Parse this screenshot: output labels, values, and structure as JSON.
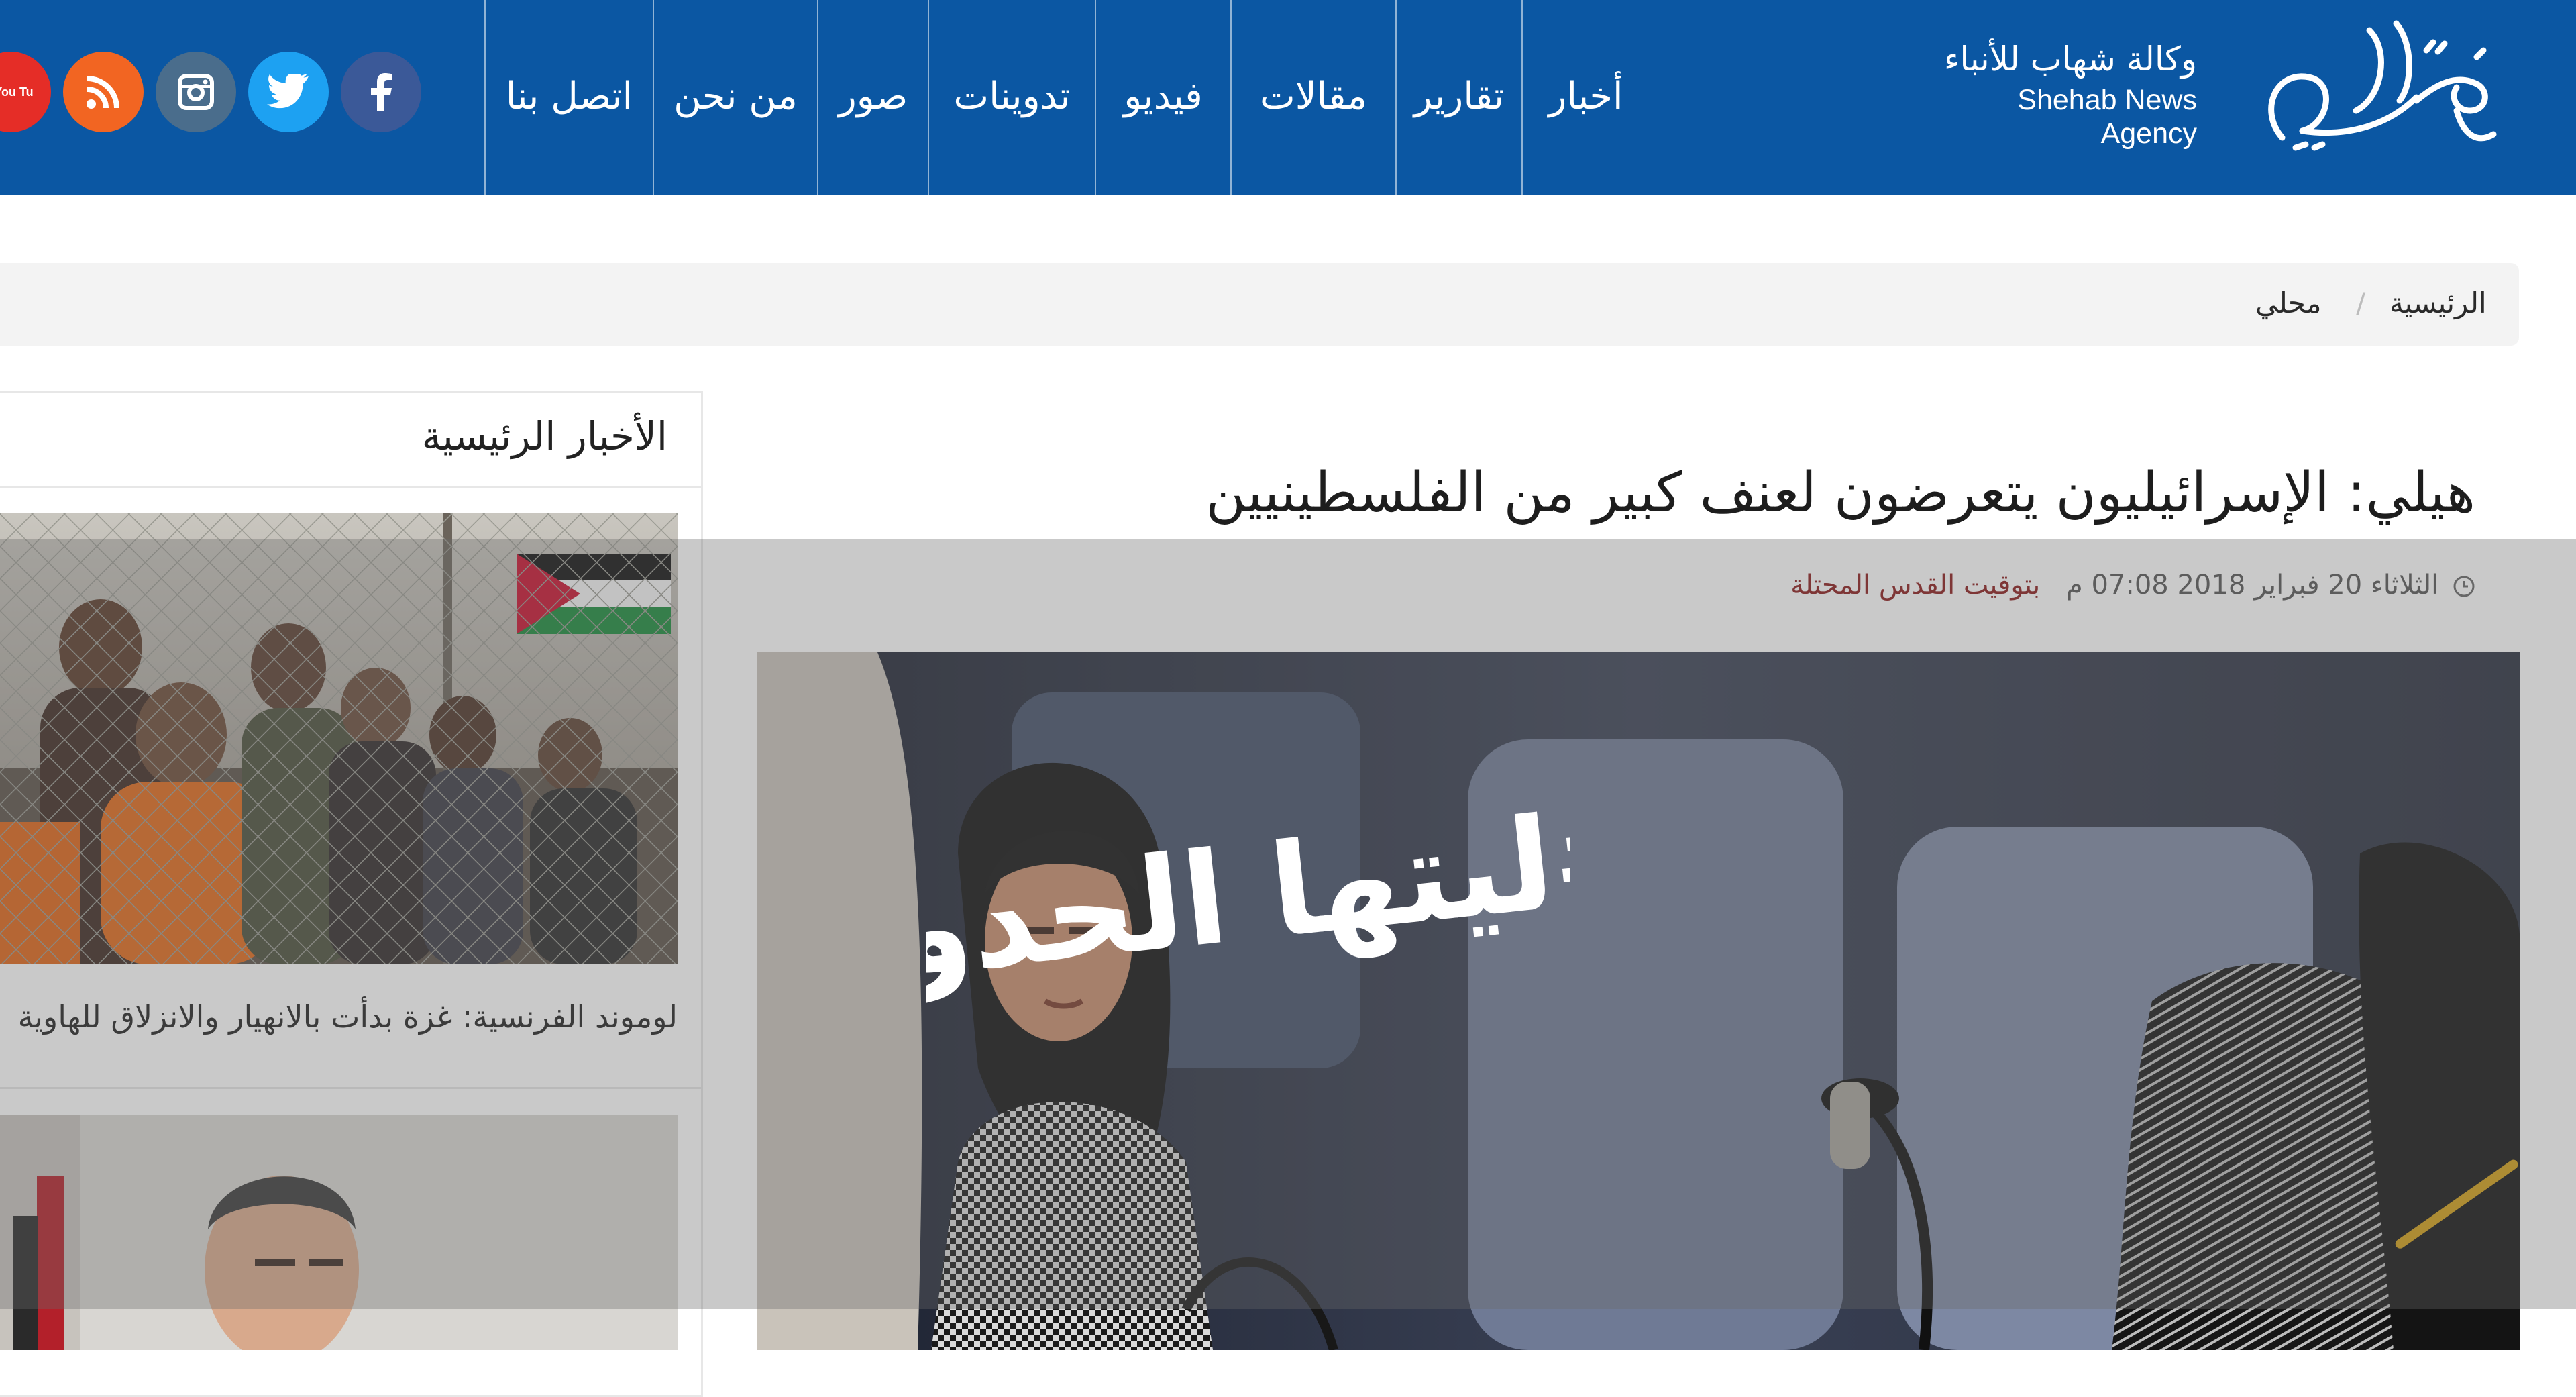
{
  "brand": {
    "name_ar": "وكالة شهاب للأنباء",
    "name_en": "Shehab News Agency",
    "logo_label": "شهاب",
    "colors": {
      "header_bg": "#0b57a3",
      "accent_red": "#8a1a1a"
    }
  },
  "nav": {
    "items": [
      {
        "label": "أخبار"
      },
      {
        "label": "تقارير"
      },
      {
        "label": "مقالات"
      },
      {
        "label": "فيديو"
      },
      {
        "label": "تدوينات"
      },
      {
        "label": "صور"
      },
      {
        "label": "من نحن"
      },
      {
        "label": "اتصل بنا"
      }
    ]
  },
  "social": {
    "items": [
      {
        "icon": "facebook-icon",
        "color": "#3b5998"
      },
      {
        "icon": "twitter-icon",
        "color": "#1da1f2"
      },
      {
        "icon": "instagram-icon",
        "color": "#4a6d8c"
      },
      {
        "icon": "rss-icon",
        "color": "#f26522"
      },
      {
        "icon": "youtube-icon",
        "color": "#e52d27",
        "text": "You Tube"
      }
    ]
  },
  "breadcrumb": {
    "home": "الرئيسية",
    "separator": "/",
    "current": "محلي"
  },
  "sidebar": {
    "title": "الأخبار الرئيسية",
    "items": [
      {
        "caption": "لوموند الفرنسية: غزة بدأت بالانهيار والانزلاق للهاوية"
      }
    ]
  },
  "article": {
    "title": "هيلي: الإسرائيليون يتعرضون لعنف كبير من الفلسطينيين",
    "date": "الثلاثاء 20 فبراير 2018 07:08 م",
    "timezone": "بتوقيت القدس المحتلة"
  },
  "overlay": {
    "hashtag": "#ليتها الحدود"
  }
}
